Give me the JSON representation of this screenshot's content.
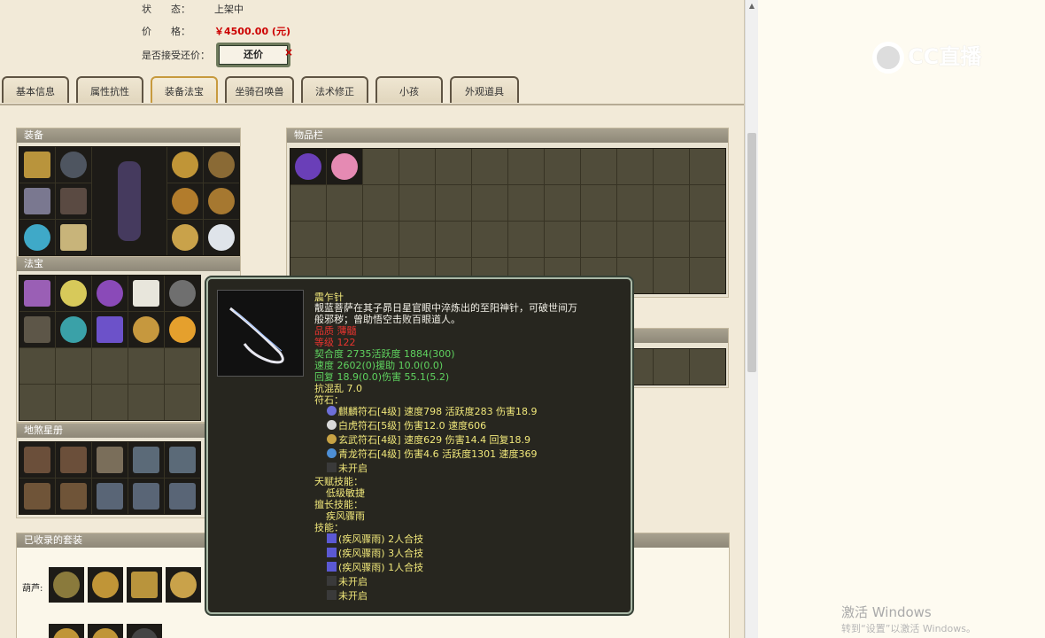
{
  "info": {
    "status_label": "状　　态：",
    "status_value": "上架中",
    "price_label": "价　　格：",
    "price_value": "￥4500.00 (元)",
    "counter_label": "是否接受还价：",
    "counter_button": "还价",
    "close_mark": "×"
  },
  "tabs": [
    "基本信息",
    "属性抗性",
    "装备法宝",
    "坐骑召唤兽",
    "法术修正",
    "小孩",
    "外观道具"
  ],
  "active_tab_index": 2,
  "panels": {
    "equipment": "装备",
    "treasure": "法宝",
    "inventory": "物品栏",
    "collection": "地煞星册",
    "suits": "已收录的套装",
    "suits_row_label": "葫芦:"
  },
  "tooltip": {
    "name": "震乍针",
    "desc_line1": "靓蓝菩萨在其子昴日星官眼中淬炼出的至阳神针，可破世间万",
    "desc_line2": "般邪秽；曾助悟空击败百眼道人。",
    "quality": "品质  薄髓",
    "level": "等级  122",
    "stat1": "契合度     2735活跃度    1884(300)",
    "stat2": "速度      2602(0)援助      10.0(0.0)",
    "stat3": "回复      18.9(0.0)伤害      55.1(5.2)",
    "stat4": "抗混乱 7.0",
    "runes_header": "符石：",
    "runes": [
      "麒麟符石[4级] 速度798 活跃度283 伤害18.9",
      "白虎符石[5级] 伤害12.0 速度606",
      "玄武符石[4级] 速度629 伤害14.4 回复18.9",
      "青龙符石[4级] 伤害4.6 活跃度1301 速度369",
      "未开启"
    ],
    "talent_header": "天赋技能：",
    "talent": "低级敏捷",
    "special_header": "擅长技能：",
    "special": "疾风骤雨",
    "skills_header": "技能：",
    "skills": [
      "(疾风骤雨) 2人合技",
      "(疾风骤雨) 3人合技",
      "(疾风骤雨) 1人合技",
      "未开启",
      "未开启"
    ]
  },
  "watermark": {
    "logo_text": "CC直播",
    "win_line1": "激活 Windows",
    "win_line2": "转到“设置”以激活 Windows。"
  },
  "colors": {
    "price": "#cc0000",
    "tooltip_bg": "#27261f",
    "yellow_text": "#f0e77a",
    "green_text": "#5fd35f",
    "red_text": "#e8342f"
  }
}
